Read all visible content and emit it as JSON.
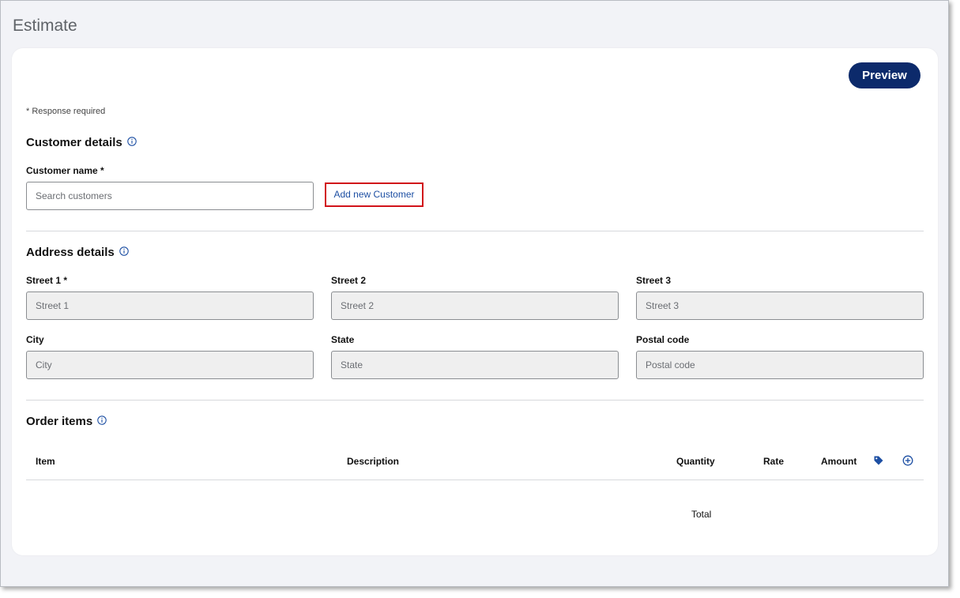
{
  "page": {
    "title": "Estimate"
  },
  "toolbar": {
    "preview_label": "Preview"
  },
  "form": {
    "required_note": "* Response required",
    "customer": {
      "section_title": "Customer details",
      "name_label": "Customer name *",
      "name_placeholder": "Search customers",
      "add_new_label": "Add new Customer"
    },
    "address": {
      "section_title": "Address details",
      "street1_label": "Street 1 *",
      "street1_placeholder": "Street 1",
      "street2_label": "Street 2",
      "street2_placeholder": "Street 2",
      "street3_label": "Street 3",
      "street3_placeholder": "Street 3",
      "city_label": "City",
      "city_placeholder": "City",
      "state_label": "State",
      "state_placeholder": "State",
      "postal_label": "Postal code",
      "postal_placeholder": "Postal code"
    },
    "order": {
      "section_title": "Order items",
      "columns": {
        "item": "Item",
        "description": "Description",
        "quantity": "Quantity",
        "rate": "Rate",
        "amount": "Amount"
      },
      "total_label": "Total",
      "icons": {
        "tag": "tag-icon",
        "add": "plus-circle-icon",
        "info": "info-icon"
      }
    }
  },
  "colors": {
    "primary": "#0c2a6b",
    "link": "#1d4fa3",
    "highlight": "#d1131a",
    "info": "#1d4fa3"
  }
}
